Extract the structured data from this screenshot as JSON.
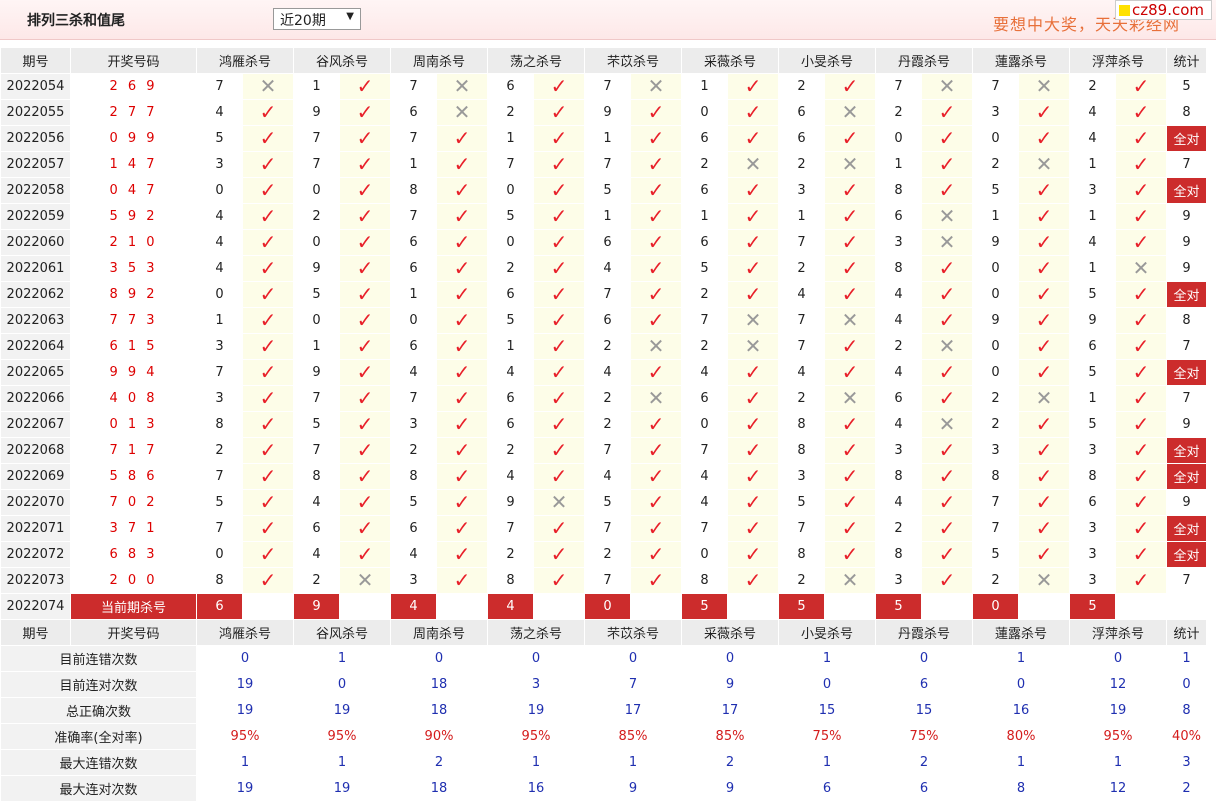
{
  "header": {
    "title": "排列三杀和值尾",
    "period_select": "近20期",
    "slogan": "要想中大奖，天天彩经网",
    "logo": "cz89.com"
  },
  "columns": {
    "issue": "期号",
    "draw": "开奖号码",
    "experts": [
      "鸿雁杀号",
      "谷风杀号",
      "周南杀号",
      "荡之杀号",
      "芣苡杀号",
      "采薇杀号",
      "小旻杀号",
      "丹霞杀号",
      "蓮露杀号",
      "浮萍杀号"
    ],
    "stat": "统计"
  },
  "rows": [
    {
      "issue": "2022054",
      "draw": "2 6 9",
      "kills": [
        [
          "7",
          "x"
        ],
        [
          "1",
          "v"
        ],
        [
          "7",
          "x"
        ],
        [
          "6",
          "v"
        ],
        [
          "7",
          "x"
        ],
        [
          "1",
          "v"
        ],
        [
          "2",
          "v"
        ],
        [
          "7",
          "x"
        ],
        [
          "7",
          "x"
        ],
        [
          "2",
          "v"
        ]
      ],
      "stat": "5"
    },
    {
      "issue": "2022055",
      "draw": "2 7 7",
      "kills": [
        [
          "4",
          "v"
        ],
        [
          "9",
          "v"
        ],
        [
          "6",
          "x"
        ],
        [
          "2",
          "v"
        ],
        [
          "9",
          "v"
        ],
        [
          "0",
          "v"
        ],
        [
          "6",
          "x"
        ],
        [
          "2",
          "v"
        ],
        [
          "3",
          "v"
        ],
        [
          "4",
          "v"
        ]
      ],
      "stat": "8"
    },
    {
      "issue": "2022056",
      "draw": "0 9 9",
      "kills": [
        [
          "5",
          "v"
        ],
        [
          "7",
          "v"
        ],
        [
          "7",
          "v"
        ],
        [
          "1",
          "v"
        ],
        [
          "1",
          "v"
        ],
        [
          "6",
          "v"
        ],
        [
          "6",
          "v"
        ],
        [
          "0",
          "v"
        ],
        [
          "0",
          "v"
        ],
        [
          "4",
          "v"
        ]
      ],
      "stat": "全对"
    },
    {
      "issue": "2022057",
      "draw": "1 4 7",
      "kills": [
        [
          "3",
          "v"
        ],
        [
          "7",
          "v"
        ],
        [
          "1",
          "v"
        ],
        [
          "7",
          "v"
        ],
        [
          "7",
          "v"
        ],
        [
          "2",
          "x"
        ],
        [
          "2",
          "x"
        ],
        [
          "1",
          "v"
        ],
        [
          "2",
          "x"
        ],
        [
          "1",
          "v"
        ]
      ],
      "stat": "7"
    },
    {
      "issue": "2022058",
      "draw": "0 4 7",
      "kills": [
        [
          "0",
          "v"
        ],
        [
          "0",
          "v"
        ],
        [
          "8",
          "v"
        ],
        [
          "0",
          "v"
        ],
        [
          "5",
          "v"
        ],
        [
          "6",
          "v"
        ],
        [
          "3",
          "v"
        ],
        [
          "8",
          "v"
        ],
        [
          "5",
          "v"
        ],
        [
          "3",
          "v"
        ]
      ],
      "stat": "全对"
    },
    {
      "issue": "2022059",
      "draw": "5 9 2",
      "kills": [
        [
          "4",
          "v"
        ],
        [
          "2",
          "v"
        ],
        [
          "7",
          "v"
        ],
        [
          "5",
          "v"
        ],
        [
          "1",
          "v"
        ],
        [
          "1",
          "v"
        ],
        [
          "1",
          "v"
        ],
        [
          "6",
          "x"
        ],
        [
          "1",
          "v"
        ],
        [
          "1",
          "v"
        ]
      ],
      "stat": "9"
    },
    {
      "issue": "2022060",
      "draw": "2 1 0",
      "kills": [
        [
          "4",
          "v"
        ],
        [
          "0",
          "v"
        ],
        [
          "6",
          "v"
        ],
        [
          "0",
          "v"
        ],
        [
          "6",
          "v"
        ],
        [
          "6",
          "v"
        ],
        [
          "7",
          "v"
        ],
        [
          "3",
          "x"
        ],
        [
          "9",
          "v"
        ],
        [
          "4",
          "v"
        ]
      ],
      "stat": "9"
    },
    {
      "issue": "2022061",
      "draw": "3 5 3",
      "kills": [
        [
          "4",
          "v"
        ],
        [
          "9",
          "v"
        ],
        [
          "6",
          "v"
        ],
        [
          "2",
          "v"
        ],
        [
          "4",
          "v"
        ],
        [
          "5",
          "v"
        ],
        [
          "2",
          "v"
        ],
        [
          "8",
          "v"
        ],
        [
          "0",
          "v"
        ],
        [
          "1",
          "x"
        ]
      ],
      "stat": "9"
    },
    {
      "issue": "2022062",
      "draw": "8 9 2",
      "kills": [
        [
          "0",
          "v"
        ],
        [
          "5",
          "v"
        ],
        [
          "1",
          "v"
        ],
        [
          "6",
          "v"
        ],
        [
          "7",
          "v"
        ],
        [
          "2",
          "v"
        ],
        [
          "4",
          "v"
        ],
        [
          "4",
          "v"
        ],
        [
          "0",
          "v"
        ],
        [
          "5",
          "v"
        ]
      ],
      "stat": "全对"
    },
    {
      "issue": "2022063",
      "draw": "7 7 3",
      "kills": [
        [
          "1",
          "v"
        ],
        [
          "0",
          "v"
        ],
        [
          "0",
          "v"
        ],
        [
          "5",
          "v"
        ],
        [
          "6",
          "v"
        ],
        [
          "7",
          "x"
        ],
        [
          "7",
          "x"
        ],
        [
          "4",
          "v"
        ],
        [
          "9",
          "v"
        ],
        [
          "9",
          "v"
        ]
      ],
      "stat": "8"
    },
    {
      "issue": "2022064",
      "draw": "6 1 5",
      "kills": [
        [
          "3",
          "v"
        ],
        [
          "1",
          "v"
        ],
        [
          "6",
          "v"
        ],
        [
          "1",
          "v"
        ],
        [
          "2",
          "x"
        ],
        [
          "2",
          "x"
        ],
        [
          "7",
          "v"
        ],
        [
          "2",
          "x"
        ],
        [
          "0",
          "v"
        ],
        [
          "6",
          "v"
        ]
      ],
      "stat": "7"
    },
    {
      "issue": "2022065",
      "draw": "9 9 4",
      "kills": [
        [
          "7",
          "v"
        ],
        [
          "9",
          "v"
        ],
        [
          "4",
          "v"
        ],
        [
          "4",
          "v"
        ],
        [
          "4",
          "v"
        ],
        [
          "4",
          "v"
        ],
        [
          "4",
          "v"
        ],
        [
          "4",
          "v"
        ],
        [
          "0",
          "v"
        ],
        [
          "5",
          "v"
        ]
      ],
      "stat": "全对"
    },
    {
      "issue": "2022066",
      "draw": "4 0 8",
      "kills": [
        [
          "3",
          "v"
        ],
        [
          "7",
          "v"
        ],
        [
          "7",
          "v"
        ],
        [
          "6",
          "v"
        ],
        [
          "2",
          "x"
        ],
        [
          "6",
          "v"
        ],
        [
          "2",
          "x"
        ],
        [
          "6",
          "v"
        ],
        [
          "2",
          "x"
        ],
        [
          "1",
          "v"
        ]
      ],
      "stat": "7"
    },
    {
      "issue": "2022067",
      "draw": "0 1 3",
      "kills": [
        [
          "8",
          "v"
        ],
        [
          "5",
          "v"
        ],
        [
          "3",
          "v"
        ],
        [
          "6",
          "v"
        ],
        [
          "2",
          "v"
        ],
        [
          "0",
          "v"
        ],
        [
          "8",
          "v"
        ],
        [
          "4",
          "x"
        ],
        [
          "2",
          "v"
        ],
        [
          "5",
          "v"
        ]
      ],
      "stat": "9"
    },
    {
      "issue": "2022068",
      "draw": "7 1 7",
      "kills": [
        [
          "2",
          "v"
        ],
        [
          "7",
          "v"
        ],
        [
          "2",
          "v"
        ],
        [
          "2",
          "v"
        ],
        [
          "7",
          "v"
        ],
        [
          "7",
          "v"
        ],
        [
          "8",
          "v"
        ],
        [
          "3",
          "v"
        ],
        [
          "3",
          "v"
        ],
        [
          "3",
          "v"
        ]
      ],
      "stat": "全对"
    },
    {
      "issue": "2022069",
      "draw": "5 8 6",
      "kills": [
        [
          "7",
          "v"
        ],
        [
          "8",
          "v"
        ],
        [
          "8",
          "v"
        ],
        [
          "4",
          "v"
        ],
        [
          "4",
          "v"
        ],
        [
          "4",
          "v"
        ],
        [
          "3",
          "v"
        ],
        [
          "8",
          "v"
        ],
        [
          "8",
          "v"
        ],
        [
          "8",
          "v"
        ]
      ],
      "stat": "全对"
    },
    {
      "issue": "2022070",
      "draw": "7 0 2",
      "kills": [
        [
          "5",
          "v"
        ],
        [
          "4",
          "v"
        ],
        [
          "5",
          "v"
        ],
        [
          "9",
          "x"
        ],
        [
          "5",
          "v"
        ],
        [
          "4",
          "v"
        ],
        [
          "5",
          "v"
        ],
        [
          "4",
          "v"
        ],
        [
          "7",
          "v"
        ],
        [
          "6",
          "v"
        ]
      ],
      "stat": "9"
    },
    {
      "issue": "2022071",
      "draw": "3 7 1",
      "kills": [
        [
          "7",
          "v"
        ],
        [
          "6",
          "v"
        ],
        [
          "6",
          "v"
        ],
        [
          "7",
          "v"
        ],
        [
          "7",
          "v"
        ],
        [
          "7",
          "v"
        ],
        [
          "7",
          "v"
        ],
        [
          "2",
          "v"
        ],
        [
          "7",
          "v"
        ],
        [
          "3",
          "v"
        ]
      ],
      "stat": "全对"
    },
    {
      "issue": "2022072",
      "draw": "6 8 3",
      "kills": [
        [
          "0",
          "v"
        ],
        [
          "4",
          "v"
        ],
        [
          "4",
          "v"
        ],
        [
          "2",
          "v"
        ],
        [
          "2",
          "v"
        ],
        [
          "0",
          "v"
        ],
        [
          "8",
          "v"
        ],
        [
          "8",
          "v"
        ],
        [
          "5",
          "v"
        ],
        [
          "3",
          "v"
        ]
      ],
      "stat": "全对"
    },
    {
      "issue": "2022073",
      "draw": "2 0 0",
      "kills": [
        [
          "8",
          "v"
        ],
        [
          "2",
          "x"
        ],
        [
          "3",
          "v"
        ],
        [
          "8",
          "v"
        ],
        [
          "7",
          "v"
        ],
        [
          "8",
          "v"
        ],
        [
          "2",
          "x"
        ],
        [
          "3",
          "v"
        ],
        [
          "2",
          "x"
        ],
        [
          "3",
          "v"
        ]
      ],
      "stat": "7"
    }
  ],
  "current": {
    "issue": "2022074",
    "label": "当前期杀号",
    "kills": [
      "6",
      "9",
      "4",
      "4",
      "0",
      "5",
      "5",
      "5",
      "0",
      "5"
    ]
  },
  "summary": [
    {
      "label": "目前连错次数",
      "values": [
        "0",
        "1",
        "0",
        "0",
        "0",
        "0",
        "1",
        "0",
        "1",
        "0"
      ],
      "stat": "1",
      "red": false
    },
    {
      "label": "目前连对次数",
      "values": [
        "19",
        "0",
        "18",
        "3",
        "7",
        "9",
        "0",
        "6",
        "0",
        "12"
      ],
      "stat": "0",
      "red": false
    },
    {
      "label": "总正确次数",
      "values": [
        "19",
        "19",
        "18",
        "19",
        "17",
        "17",
        "15",
        "15",
        "16",
        "19"
      ],
      "stat": "8",
      "red": false
    },
    {
      "label": "准确率(全对率)",
      "values": [
        "95%",
        "95%",
        "90%",
        "95%",
        "85%",
        "85%",
        "75%",
        "75%",
        "80%",
        "95%"
      ],
      "stat": "40%",
      "red": true
    },
    {
      "label": "最大连错次数",
      "values": [
        "1",
        "1",
        "2",
        "1",
        "1",
        "2",
        "1",
        "2",
        "1",
        "1"
      ],
      "stat": "3",
      "red": false
    },
    {
      "label": "最大连对次数",
      "values": [
        "19",
        "19",
        "18",
        "16",
        "9",
        "9",
        "6",
        "6",
        "8",
        "12"
      ],
      "stat": "2",
      "red": false
    }
  ]
}
